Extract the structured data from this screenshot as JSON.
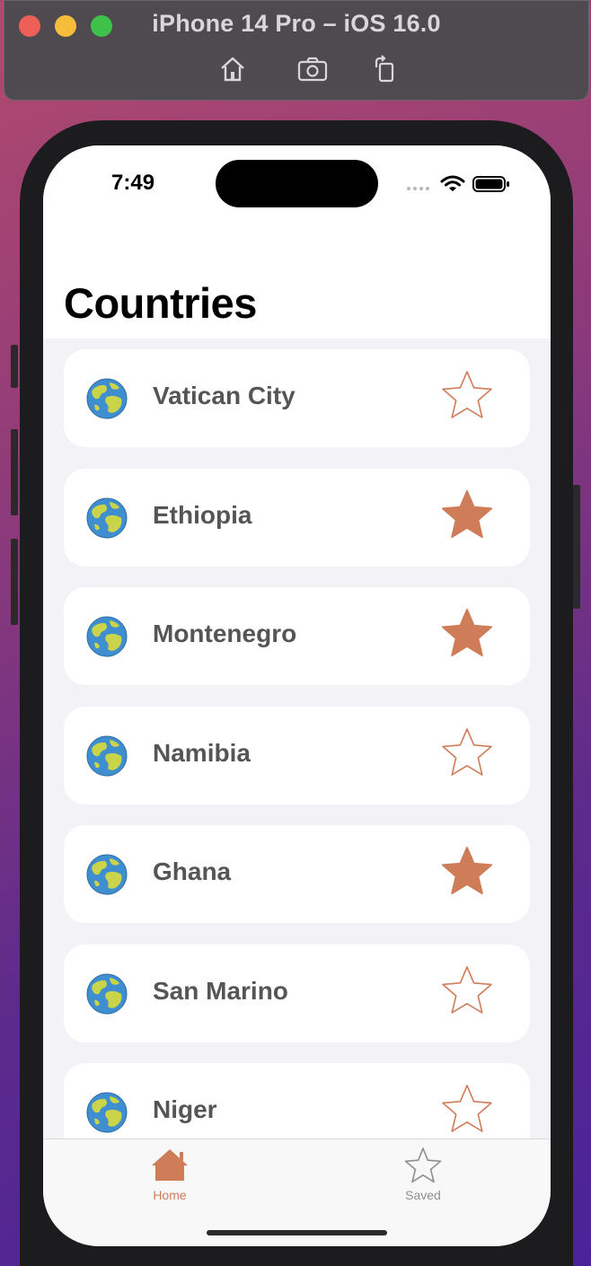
{
  "simulator": {
    "title": "iPhone 14 Pro – iOS 16.0",
    "tools": [
      "home-icon",
      "screenshot-icon",
      "rotate-icon"
    ]
  },
  "status_bar": {
    "time": "7:49"
  },
  "page": {
    "title": "Countries"
  },
  "colors": {
    "accent": "#cf7c58",
    "card": "#ffffff",
    "background": "#f2f2f7",
    "text": "#555557"
  },
  "countries": [
    {
      "name": "Vatican City",
      "favorite": false
    },
    {
      "name": "Ethiopia",
      "favorite": true
    },
    {
      "name": "Montenegro",
      "favorite": true
    },
    {
      "name": "Namibia",
      "favorite": false
    },
    {
      "name": "Ghana",
      "favorite": true
    },
    {
      "name": "San Marino",
      "favorite": false
    },
    {
      "name": "Niger",
      "favorite": false
    }
  ],
  "tabbar": {
    "items": [
      {
        "label": "Home",
        "icon": "home-icon",
        "selected": true
      },
      {
        "label": "Saved",
        "icon": "star-icon",
        "selected": false
      }
    ]
  }
}
